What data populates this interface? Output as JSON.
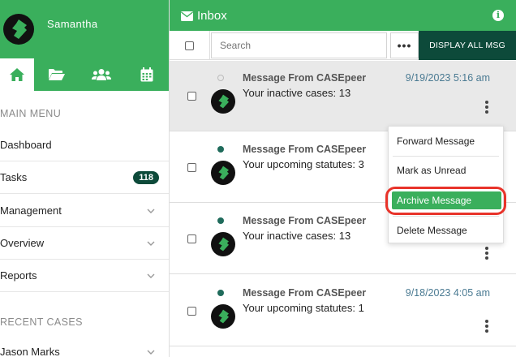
{
  "sidebar": {
    "user_name": "Samantha",
    "tabs": [
      {
        "name": "home-icon",
        "active": true
      },
      {
        "name": "folder-open-icon",
        "active": false
      },
      {
        "name": "users-icon",
        "active": false
      },
      {
        "name": "calendar-icon",
        "active": false
      }
    ],
    "main_menu_heading": "MAIN MENU",
    "menu_items": [
      {
        "label": "Dashboard"
      },
      {
        "label": "Tasks",
        "badge": "118"
      },
      {
        "label": "Management"
      },
      {
        "label": "Overview"
      },
      {
        "label": "Reports"
      }
    ],
    "recent_heading": "RECENT CASES",
    "recent_items": [
      {
        "label": "Jason Marks"
      }
    ]
  },
  "header": {
    "title": "Inbox",
    "info_icon": "i"
  },
  "toolbar": {
    "search_placeholder": "Search",
    "more_icon": "•••",
    "display_all_label": "DISPLAY ALL MSG"
  },
  "messages": [
    {
      "from": "Message From CASEpeer",
      "body": "Your inactive cases: 13",
      "date": "9/19/2023 5:16 am",
      "unread": false
    },
    {
      "from": "Message From CASEpeer",
      "body": "Your upcoming statutes: 3",
      "date": "",
      "unread": true
    },
    {
      "from": "Message From CASEpeer",
      "body": "Your inactive cases: 13",
      "date": "",
      "unread": true
    },
    {
      "from": "Message From CASEpeer",
      "body": "Your upcoming statutes: 1",
      "date": "9/18/2023 4:05 am",
      "unread": true
    }
  ],
  "context_menu": {
    "items": [
      {
        "label": "Forward Message"
      },
      {
        "label": "Mark as Unread"
      },
      {
        "label": "Archive Message",
        "highlighted": true
      },
      {
        "label": "Delete Message"
      }
    ]
  },
  "colors": {
    "brand_green": "#3aaf5c",
    "dark_teal": "#0d4a3a",
    "highlight_red": "#e8332a",
    "date_blue": "#4a7a92"
  }
}
